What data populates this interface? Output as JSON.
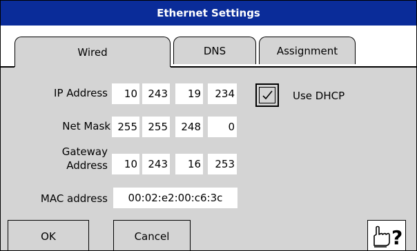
{
  "window": {
    "title": "Ethernet Settings"
  },
  "tabs": [
    {
      "label": "Wired",
      "active": true
    },
    {
      "label": "DNS",
      "active": false
    },
    {
      "label": "Assignment",
      "active": false
    }
  ],
  "form": {
    "ip_label": "IP Address",
    "ip": [
      "10",
      "243",
      "19",
      "234"
    ],
    "mask_label": "Net Mask",
    "mask": [
      "255",
      "255",
      "248",
      "0"
    ],
    "gateway_label_1": "Gateway",
    "gateway_label_2": "Address",
    "gateway": [
      "10",
      "243",
      "16",
      "253"
    ],
    "mac_label": "MAC address",
    "mac": "00:02:e2:00:c6:3c",
    "dhcp_label": "Use DHCP",
    "dhcp_checked": true
  },
  "buttons": {
    "ok": "OK",
    "cancel": "Cancel",
    "help_icon": "pointing-hand-question-icon"
  },
  "colors": {
    "titlebar": "#0a2c99",
    "panel": "#d4d4d4",
    "field": "#ffffff"
  }
}
